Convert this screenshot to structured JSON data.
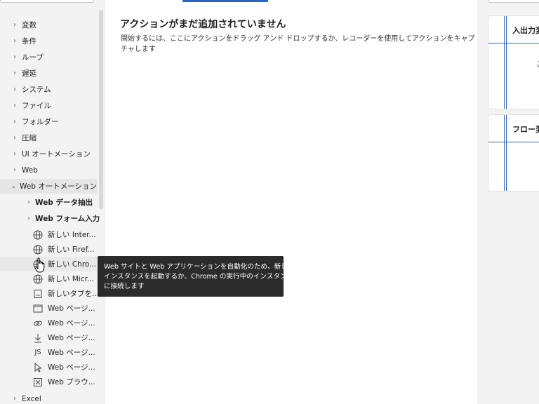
{
  "actions_pane": {
    "groups": [
      {
        "label": "変数"
      },
      {
        "label": "条件"
      },
      {
        "label": "ループ"
      },
      {
        "label": "遅延"
      },
      {
        "label": "システム"
      },
      {
        "label": "ファイル"
      },
      {
        "label": "フォルダー"
      },
      {
        "label": "圧縮"
      },
      {
        "label": "UI オートメーション"
      },
      {
        "label": "Web"
      },
      {
        "label": "Web オートメーション"
      }
    ],
    "subgroups": [
      {
        "label": "Web データ抽出"
      },
      {
        "label": "Web フォーム入力"
      }
    ],
    "actions": [
      {
        "label": "新しい Inter...",
        "icon": "globe-icon"
      },
      {
        "label": "新しい Firef...",
        "icon": "globe-icon"
      },
      {
        "label": "新しい Chro...",
        "icon": "globe-icon"
      },
      {
        "label": "新しい Micr...",
        "icon": "globe-icon"
      },
      {
        "label": "新しいタブを...",
        "icon": "new-tab-icon"
      },
      {
        "label": "Web ページ...",
        "icon": "window-icon"
      },
      {
        "label": "Web ページ...",
        "icon": "link-icon"
      },
      {
        "label": "Web ページ...",
        "icon": "download-arrow-icon"
      },
      {
        "label": "Web ページ...",
        "icon": "js-icon"
      },
      {
        "label": "Web ページ...",
        "icon": "pointer-icon"
      },
      {
        "label": "Web ブラウ...",
        "icon": "close-box-icon"
      }
    ],
    "bottom_group": {
      "label": "Excel"
    }
  },
  "canvas": {
    "empty_title": "アクションがまだ追加されていません",
    "empty_description": "開始するには、ここにアクションをドラッグ アンド ドロップするか、レコーダーを使用してアクションをキャプチャします"
  },
  "variables_pane": {
    "io_title": "入出力変",
    "io_body_glyph": "こ",
    "flow_title": "フロー変"
  },
  "tooltip": {
    "line1": "Web サイトと Web アプリケーションを自動化のため、新しい",
    "line2": "インスタンスを起動するか、Chrome の実行中のインスタンス",
    "line3": "に接続します"
  }
}
